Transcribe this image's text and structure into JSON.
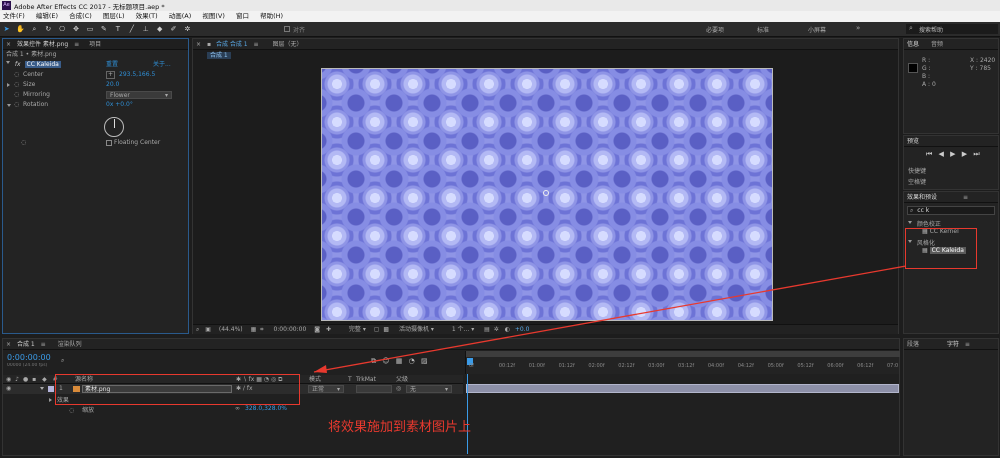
{
  "window": {
    "title": "Adobe After Effects CC 2017 - 无标题项目.aep *",
    "app_icon": "Ae"
  },
  "menu": [
    "文件(F)",
    "编辑(E)",
    "合成(C)",
    "图层(L)",
    "效果(T)",
    "动画(A)",
    "视图(V)",
    "窗口",
    "帮助(H)"
  ],
  "toolbar": {
    "tools": [
      "selection-tool",
      "hand-tool",
      "zoom-tool",
      "rotate-tool",
      "camera-tool",
      "pan-behind-tool",
      "rectangle-tool",
      "pen-tool",
      "type-tool",
      "brush-tool",
      "clone-stamp-tool",
      "eraser-tool",
      "roto-brush-tool",
      "puppet-tool"
    ],
    "snap_label": "对齐",
    "workspaces": [
      "必要项",
      "标准",
      "小屏幕"
    ],
    "search_placeholder": "搜索帮助"
  },
  "effect_controls": {
    "tab_label": "效果控件 素材.png",
    "tab2_label": "项目",
    "breadcrumb": "合成 1 • 素材.png",
    "effect_name": "CC Kaleida",
    "reset_label": "重置",
    "about_label": "关于...",
    "props": [
      {
        "name": "Center",
        "value": "293.5,166.5"
      },
      {
        "name": "Size",
        "value": "20.0"
      },
      {
        "name": "Mirroring",
        "value": "Flower"
      },
      {
        "name": "Rotation",
        "value": "0x +0.0°"
      }
    ],
    "floating_center": "Floating Center"
  },
  "composition": {
    "tab_label": "合成 合成 1",
    "layer_tab": "图层（无）",
    "sub_tab": "合成 1",
    "zoom": "(44.4%)",
    "timecode": "0:00:00:00",
    "quality": "完整",
    "camera": "活动摄像机",
    "views": "1 个...",
    "exposure": "+0.0"
  },
  "right_panels": {
    "info_tab": "信息",
    "audio_tab": "音频",
    "info_rgb": [
      "R :",
      "G :",
      "B :",
      "A : 0"
    ],
    "info_xy": [
      "X : 2420",
      "Y : 785"
    ],
    "preview_tab": "预览",
    "shortcut_label": "快捷键",
    "shortcut_value": "空格键",
    "effects_tab": "效果和预设",
    "search_value": "cc k",
    "groups": [
      {
        "name": "颜色校正",
        "items": [
          "CC Kernel"
        ]
      },
      {
        "name": "风格化",
        "items": [
          "CC Kaleida"
        ]
      }
    ],
    "para_tab": "段落",
    "char_tab": "字符"
  },
  "timeline": {
    "tab_label": "合成 1",
    "render_tab": "渲染队列",
    "timecode": "0:00:00:00",
    "frame_info": "00000 (24.00 fps)",
    "columns": [
      "源名称",
      "模式",
      "T",
      "TrkMat",
      "父级"
    ],
    "layer": {
      "number": "1",
      "name": "素材.png",
      "mode": "正常",
      "parent": "无"
    },
    "effects_label": "效果",
    "scale_label": "缩放",
    "scale_value": "328.0,328.0%",
    "ruler": [
      "0f",
      "00:12f",
      "01:00f",
      "01:12f",
      "02:00f",
      "02:12f",
      "03:00f",
      "03:12f",
      "04:00f",
      "04:12f",
      "05:00f",
      "05:12f",
      "06:00f",
      "06:12f",
      "07:0"
    ]
  },
  "annotation": {
    "text": "将效果施加到素材图片上",
    "color": "#e8392e"
  }
}
